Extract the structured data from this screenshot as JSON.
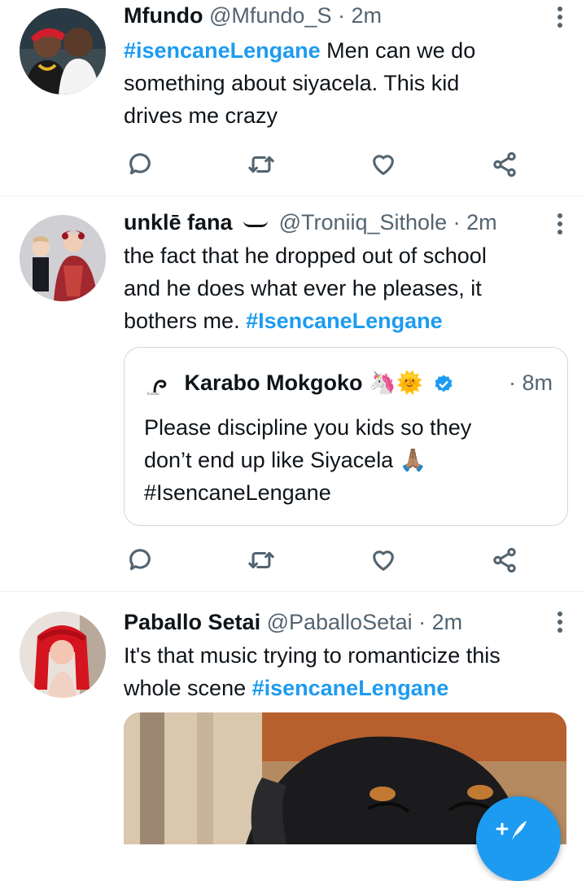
{
  "tweets": [
    {
      "name": "Mfundo",
      "handle": "@Mfundo_S",
      "time": "· 2m",
      "hashtag": "#isencaneLengane",
      "text_line1_rest": " Men can we do",
      "text_line2": "something about siyacela. This kid",
      "text_line3": "drives me crazy"
    },
    {
      "name": "unklē fana",
      "handle": "@Troniiq_Sithole",
      "time": "· 2m",
      "text_line1": "the fact that he dropped out of school",
      "text_line2": "and he does what ever he pleases, it",
      "text_line3_start": "bothers me. ",
      "hashtag": "#IsencaneLengane",
      "quote": {
        "name": "Karabo Mokgoko",
        "emoji": "🦄🌞",
        "time": "· 8m",
        "line1": "Please discipline you kids so they",
        "line2": "don’t end up like Siyacela 🙏🏽",
        "line3": "#IsencaneLengane"
      }
    },
    {
      "name": "Paballo Setai",
      "handle": "@PaballoSetai",
      "time": "· 2m",
      "line1": "It's that music trying to romanticize this",
      "line2_start": "whole scene ",
      "hashtag": "#isencaneLengane"
    }
  ],
  "colors": {
    "accent": "#1d9bf0",
    "muted": "#536471",
    "text": "#0f1419"
  },
  "icons": [
    "reply-icon",
    "retweet-icon",
    "like-icon",
    "share-icon",
    "more-icon",
    "verified-icon",
    "compose-icon"
  ]
}
